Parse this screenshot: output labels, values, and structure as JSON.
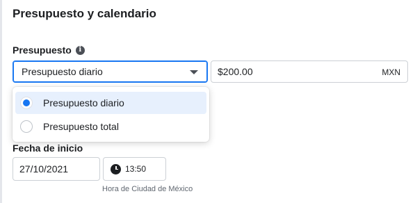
{
  "section": {
    "title": "Presupuesto y calendario"
  },
  "budget": {
    "label": "Presupuesto",
    "info_icon": "i",
    "selected": "Presupuesto diario",
    "amount": "$200.00",
    "currency": "MXN",
    "options": [
      {
        "label": "Presupuesto diario",
        "selected": true
      },
      {
        "label": "Presupuesto total",
        "selected": false
      }
    ]
  },
  "schedule": {
    "start_label": "Fecha de inicio",
    "start_date": "27/10/2021",
    "start_time": "13:50",
    "timezone": "Hora de Ciudad de México"
  },
  "colors": {
    "accent": "#1877f2",
    "selected_bg": "#e7f0fd"
  }
}
